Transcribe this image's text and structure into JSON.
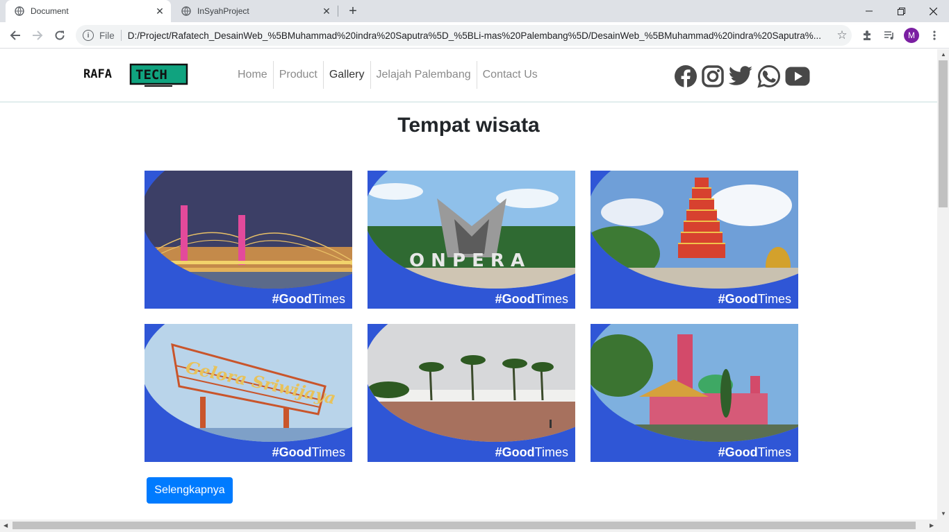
{
  "browser": {
    "tabs": [
      {
        "title": "Document",
        "active": true
      },
      {
        "title": "InSyahProject",
        "active": false
      }
    ],
    "new_tab_symbol": "+",
    "address": {
      "scheme_label": "File",
      "url": "D:/Project/Rafatech_DesainWeb_%5BMuhammad%20indra%20Saputra%5D_%5BLi-mas%20Palembang%5D/DesainWeb_%5BMuhammad%20indra%20Saputra%..."
    },
    "profile_initial": "M"
  },
  "site": {
    "logo_text": {
      "left": "RAFA",
      "right": "TECH"
    },
    "nav": [
      {
        "label": "Home",
        "active": false
      },
      {
        "label": "Product",
        "active": false
      },
      {
        "label": "Gallery",
        "active": true
      },
      {
        "label": "Jelajah Palembang",
        "active": false
      },
      {
        "label": "Contact Us",
        "active": false
      }
    ],
    "social_icons": [
      "facebook-icon",
      "instagram-icon",
      "twitter-icon",
      "whatsapp-icon",
      "youtube-icon"
    ],
    "heading": "Tempat wisata",
    "gallery": [
      {
        "image": "ampera-bridge-night",
        "tag_bold": "#Good",
        "tag_rest": "Times"
      },
      {
        "image": "monpera-monument",
        "tag_bold": "#Good",
        "tag_rest": "Times",
        "sign_text": "O N P E R A"
      },
      {
        "image": "pagoda-kemaro-island",
        "tag_bold": "#Good",
        "tag_rest": "Times"
      },
      {
        "image": "gelora-sriwijaya-sign",
        "tag_bold": "#Good",
        "tag_rest": "Times",
        "sign_text": "Gelora Sriwijaya"
      },
      {
        "image": "benteng-kuto-besak-plaza",
        "tag_bold": "#Good",
        "tag_rest": "Times"
      },
      {
        "image": "cheng-ho-mosque",
        "tag_bold": "#Good",
        "tag_rest": "Times"
      }
    ],
    "more_button": "Selengkapnya"
  },
  "colors": {
    "card_blue": "#2f56d6",
    "button_blue": "#007bff",
    "logo_teal": "#10a37f"
  }
}
